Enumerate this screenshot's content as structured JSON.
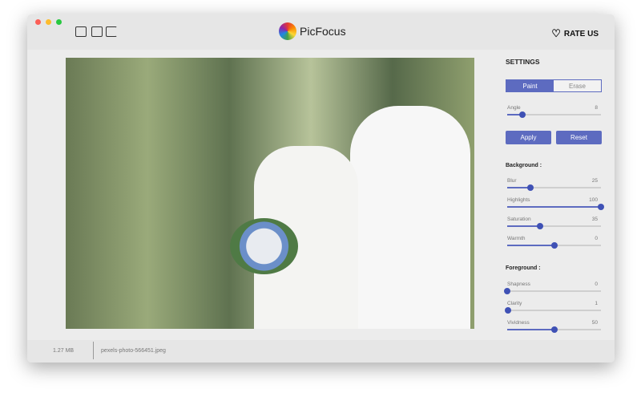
{
  "app": {
    "title": "PicFocus",
    "rate_label": "RATE US",
    "accent": "#5d6bc0"
  },
  "toolbar": {
    "icons": [
      "open-image-icon",
      "save-icon",
      "share-icon"
    ]
  },
  "settings": {
    "title": "SETTINGS",
    "mode_tabs": [
      "Paint",
      "Erase"
    ],
    "active_mode": "Paint",
    "angle": {
      "label": "Angle",
      "value": 8,
      "max": 50
    },
    "apply_label": "Apply",
    "reset_label": "Reset",
    "background_title": "Background :",
    "background": [
      {
        "label": "Blur",
        "value": 25,
        "max": 100
      },
      {
        "label": "Highlights",
        "value": 100,
        "max": 100
      },
      {
        "label": "Saturation",
        "value": 35,
        "max": 100
      },
      {
        "label": "Warmth",
        "value": 0,
        "min": -100,
        "max": 100
      }
    ],
    "foreground_title": "Foreground :",
    "foreground": [
      {
        "label": "Shapness",
        "value": 0,
        "max": 100
      },
      {
        "label": "Clarity",
        "value": 1,
        "max": 100
      },
      {
        "label": "Vividness",
        "value": 50,
        "max": 100
      }
    ]
  },
  "footer": {
    "file_size": "1.27 MB",
    "file_name": "pexels-photo-566451.jpeg"
  }
}
